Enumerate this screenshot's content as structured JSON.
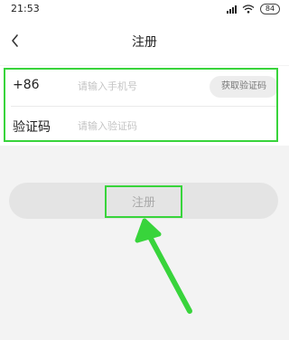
{
  "status_bar": {
    "time": "21:53",
    "battery": "84",
    "icons": [
      "signal-icon",
      "wifi-icon",
      "battery-icon"
    ]
  },
  "nav": {
    "title": "注册",
    "back_icon": "chevron-left-icon"
  },
  "form": {
    "phone": {
      "label": "+86",
      "placeholder": "请输入手机号",
      "value": ""
    },
    "code": {
      "label": "验证码",
      "placeholder": "请输入验证码",
      "value": ""
    },
    "get_code_label": "获取验证码"
  },
  "register": {
    "label": "注册",
    "enabled": false
  },
  "annotation": {
    "highlight_color": "#38d43b"
  }
}
